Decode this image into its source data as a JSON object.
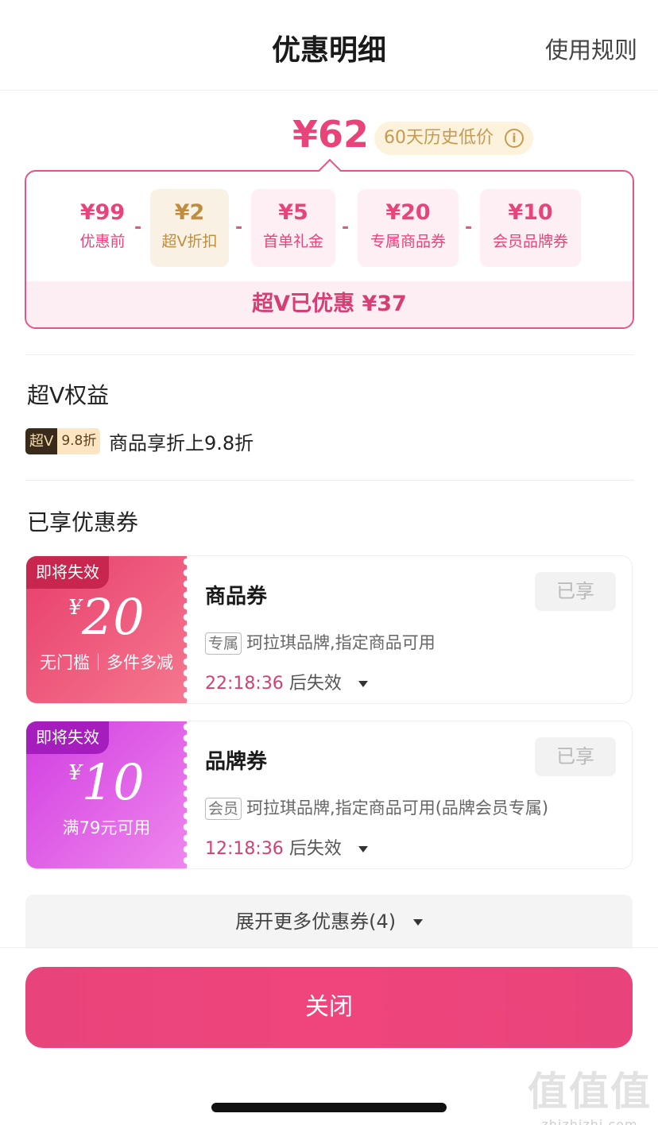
{
  "header": {
    "title": "优惠明细",
    "rules_link": "使用规则"
  },
  "price": {
    "final": "¥62",
    "history_badge": "60天历史低价",
    "info_icon": "i"
  },
  "calc": {
    "items": [
      {
        "amount": "¥99",
        "label": "优惠前"
      },
      {
        "amount": "¥2",
        "label": "超V折扣"
      },
      {
        "amount": "¥5",
        "label": "首单礼金"
      },
      {
        "amount": "¥20",
        "label": "专属商品券"
      },
      {
        "amount": "¥10",
        "label": "会员品牌券"
      }
    ],
    "minus": "-",
    "total_saved": "超V已优惠 ¥37"
  },
  "svip": {
    "title": "超V权益",
    "badge_left": "超V",
    "badge_right": "9.8折",
    "desc": "商品享折上9.8折"
  },
  "coupons": {
    "title": "已享优惠券",
    "items": [
      {
        "expire_tag": "即将失效",
        "currency": "¥",
        "amount": "20",
        "condition": "无门槛｜多件多减",
        "name": "商品券",
        "status": "已享",
        "tag": "专属",
        "desc": "珂拉琪品牌,指定商品可用",
        "time": "22:18:36",
        "expire_suffix": "后失效"
      },
      {
        "expire_tag": "即将失效",
        "currency": "¥",
        "amount": "10",
        "condition": "满79元可用",
        "name": "品牌券",
        "status": "已享",
        "tag": "会员",
        "desc": "珂拉琪品牌,指定商品可用(品牌会员专属)",
        "time": "12:18:36",
        "expire_suffix": "后失效"
      }
    ],
    "expand": "展开更多优惠券(4)"
  },
  "close_button": "关闭",
  "watermark": {
    "big": "值值值",
    "small": "zhizhizhi.com"
  },
  "colors": {
    "accent": "#e8447a",
    "gold": "#c59a52",
    "purple": "#d13ee0"
  }
}
